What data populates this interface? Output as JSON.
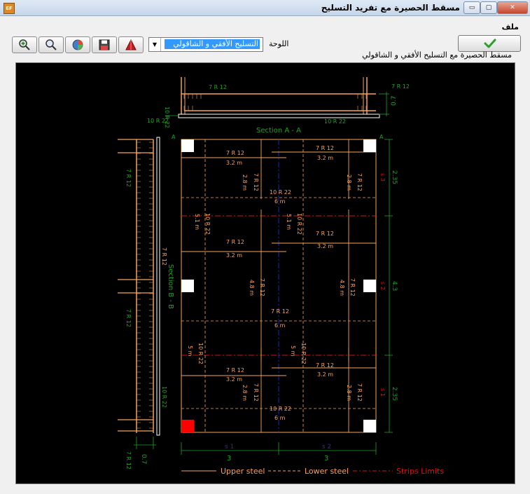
{
  "window": {
    "title": "مسقط الحصيرة مع تفريد التسليح",
    "icon_text": "EF",
    "minimize_symbol": "▭",
    "maximize_symbol": "▢",
    "close_symbol": "✕"
  },
  "menu": {
    "file": "ملف"
  },
  "toolbar": {
    "icons": [
      "zoom-in-icon",
      "zoom-icon",
      "pie-chart-icon",
      "save-icon",
      "pyramid-icon"
    ],
    "panel_label": "اللوحة",
    "panel_selected": "التسليح الأفقي و الشاقولي",
    "dropdown_arrow": "▼"
  },
  "subtitle": "مسقط الحصيرة مع التسليح الأفقي و الشاقولي",
  "drawing": {
    "top_rebar_label": "7 R 12",
    "top_dim": "0.7",
    "top_bottom_bars": "10 R 22",
    "top_left_bars": "10 R 22",
    "section_aa": "Section A - A",
    "section_bb": "Section B - B",
    "section_a_mark": "A",
    "bars_7r12": "7 R 12",
    "bars_10r22": "10 R 22",
    "len_32": "3.2 m",
    "len_28": "2.8 m",
    "len_48": "4.8 m",
    "len_6": "6 m",
    "len_51": "5.1 m",
    "len_5": "5 m",
    "right_dims": [
      "2.35",
      "4.3",
      "2.35"
    ],
    "right_strips": [
      "s 3",
      "s 2",
      "s 1"
    ],
    "bottom_strips": [
      "s 1",
      "s 2"
    ],
    "bottom_dims": [
      "3",
      "3"
    ],
    "left_dim": "0.7",
    "left_bars_bottom": "7 R 12",
    "legend": {
      "upper": "Upper steel",
      "lower": "Lower steel",
      "strips": "Strips Limits"
    }
  },
  "colors": {
    "rebar": "#f5a35c",
    "dims": "#22a322",
    "strips": "#d01414",
    "axis": "#2727c8",
    "column": "#ffffff",
    "column_active": "#ff0000"
  }
}
